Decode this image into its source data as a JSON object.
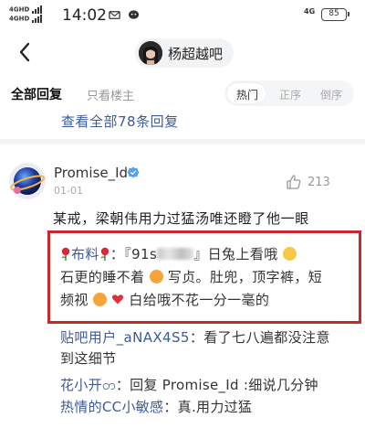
{
  "status_bar": {
    "signal1": "4GHD",
    "signal2": "4GHD",
    "time": "14:02",
    "network": "4G",
    "battery": "85"
  },
  "nav": {
    "forum_name": "杨超越吧"
  },
  "tabs": {
    "all_replies": "全部回复",
    "op_only": "只看楼主",
    "sort": [
      "热门",
      "正序",
      "倒序"
    ]
  },
  "view_all": "查看全部78条回复",
  "post": {
    "username": "Promise_Id",
    "date": "01-01",
    "like_count": "213",
    "text": "某戒，梁朝伟用力过猛汤唯还瞪了他一眼"
  },
  "replies": [
    {
      "nick": "布料",
      "line1_a": "：『91s",
      "line1_b": "』日兔上看哦",
      "line2_a": "石更的睡不着",
      "line2_b": "写贞。肚兜，顶字裤，短",
      "line3_a": "频视",
      "line3_b": "白给哦不花一分一毫的"
    },
    {
      "nick": "贴吧用户_aNAX4S5",
      "text1": "：看了七八遍都没注意",
      "text2": "到这细节"
    },
    {
      "nick": "花小开တ",
      "text": "：回复 Promise_Id :细说几分钟"
    },
    {
      "nick": "热情的CC小敏感",
      "text": "：真.用力过猛"
    }
  ],
  "colors": {
    "link_blue": "#3d5a9a",
    "highlight_red": "#c62a2a"
  }
}
